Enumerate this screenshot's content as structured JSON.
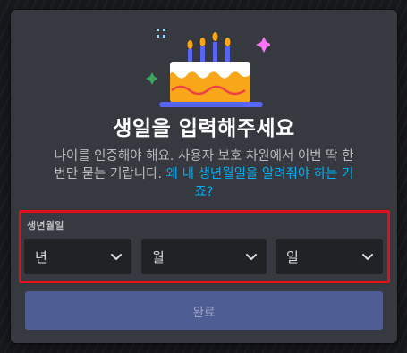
{
  "modal": {
    "title": "생일을 입력해주세요",
    "description_line1": "나이를 인증해야 해요. 사용자 보호 차원에서 이번 딱 한",
    "description_line2_prefix": "번만 묻는 거랍니다. ",
    "description_link_part1": "왜 내 생년월일을 알려줘야 하는 거",
    "description_link_part2": "죠?"
  },
  "dob": {
    "label": "생년월일",
    "year_placeholder": "년",
    "month_placeholder": "월",
    "day_placeholder": "일"
  },
  "submit": {
    "label": "완료"
  },
  "colors": {
    "modal_bg": "#36393f",
    "link": "#00aff4",
    "highlight_border": "#e0111a",
    "button_bg": "#4e5d94"
  },
  "icons": [
    "birthday-cake-icon",
    "chevron-down-icon",
    "sparkle-icon"
  ]
}
